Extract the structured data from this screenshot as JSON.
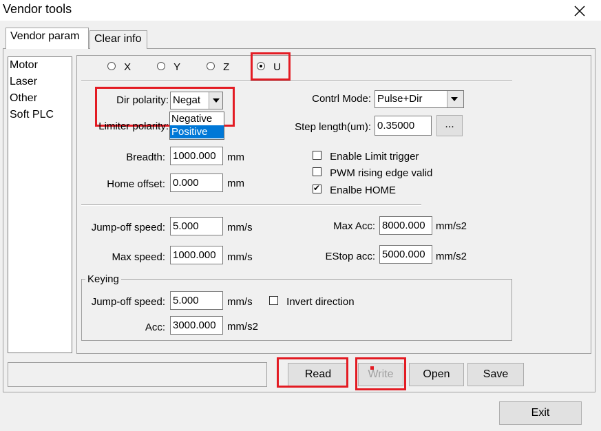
{
  "window": {
    "title": "Vendor tools",
    "close_glyph": "X"
  },
  "tabs": [
    {
      "label": "Vendor param"
    },
    {
      "label": "Clear info"
    }
  ],
  "sidebar": {
    "items": [
      "Motor",
      "Laser",
      "Other",
      "Soft PLC"
    ]
  },
  "axes": {
    "options": [
      "X",
      "Y",
      "Z",
      "U"
    ],
    "selected": "U"
  },
  "fields": {
    "dir_polarity": {
      "label": "Dir polarity:",
      "value": "Negat"
    },
    "limiter_polarity": {
      "label": "Limiter polarity:"
    },
    "breadth": {
      "label": "Breadth:",
      "value": "1000.000",
      "unit": "mm"
    },
    "home_offset": {
      "label": "Home offset:",
      "value": "0.000",
      "unit": "mm"
    },
    "contrl_mode": {
      "label": "Contrl Mode:",
      "value": "Pulse+Dir"
    },
    "step_length": {
      "label": "Step length(um):",
      "value": "0.35000",
      "browse": "..."
    },
    "jump_off_speed": {
      "label": "Jump-off speed:",
      "value": "5.000",
      "unit": "mm/s"
    },
    "max_speed": {
      "label": "Max speed:",
      "value": "1000.000",
      "unit": "mm/s"
    },
    "max_acc": {
      "label": "Max Acc:",
      "value": "8000.000",
      "unit": "mm/s2"
    },
    "estop_acc": {
      "label": "EStop acc:",
      "value": "5000.000",
      "unit": "mm/s2"
    }
  },
  "dropdown_popup": {
    "options": [
      "Negative",
      "Positive"
    ],
    "highlighted": "Positive"
  },
  "checkboxes": [
    {
      "label": "Enable Limit trigger",
      "checked": false
    },
    {
      "label": "PWM rising edge valid",
      "checked": false
    },
    {
      "label": "Enalbe HOME",
      "checked": true
    }
  ],
  "keying": {
    "title": "Keying",
    "jump_off_speed": {
      "label": "Jump-off speed:",
      "value": "5.000",
      "unit": "mm/s"
    },
    "acc": {
      "label": "Acc:",
      "value": "3000.000",
      "unit": "mm/s2"
    },
    "invert_direction": {
      "label": "Invert direction",
      "checked": false
    }
  },
  "buttons": {
    "read": "Read",
    "write": "Write",
    "open": "Open",
    "save": "Save",
    "exit": "Exit"
  },
  "colors": {
    "highlight": "#e31b23",
    "selection": "#0078d7"
  }
}
